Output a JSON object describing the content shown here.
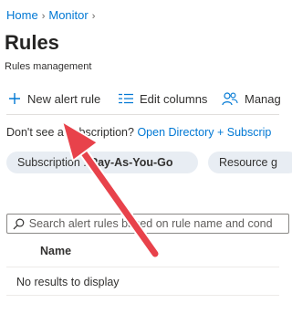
{
  "breadcrumb": {
    "home": "Home",
    "monitor": "Monitor",
    "separator": "›"
  },
  "page": {
    "title": "Rules",
    "subtitle": "Rules management"
  },
  "toolbar": {
    "new_alert_rule": "New alert rule",
    "edit_columns": "Edit columns",
    "manage": "Manag"
  },
  "notice": {
    "text": "Don't see a subscription?",
    "link": "Open Directory + Subscrip"
  },
  "filters": {
    "subscription_label": "Subscription :",
    "subscription_value": "Pay-As-You-Go",
    "resource_label": "Resource g"
  },
  "search": {
    "placeholder": "Search alert rules based on rule name and cond"
  },
  "table": {
    "columns": [
      "Name"
    ],
    "empty_message": "No results to display"
  },
  "colors": {
    "link": "#0078d4",
    "annotation_arrow": "#e8424b",
    "pill_bg": "#e8edf3"
  }
}
